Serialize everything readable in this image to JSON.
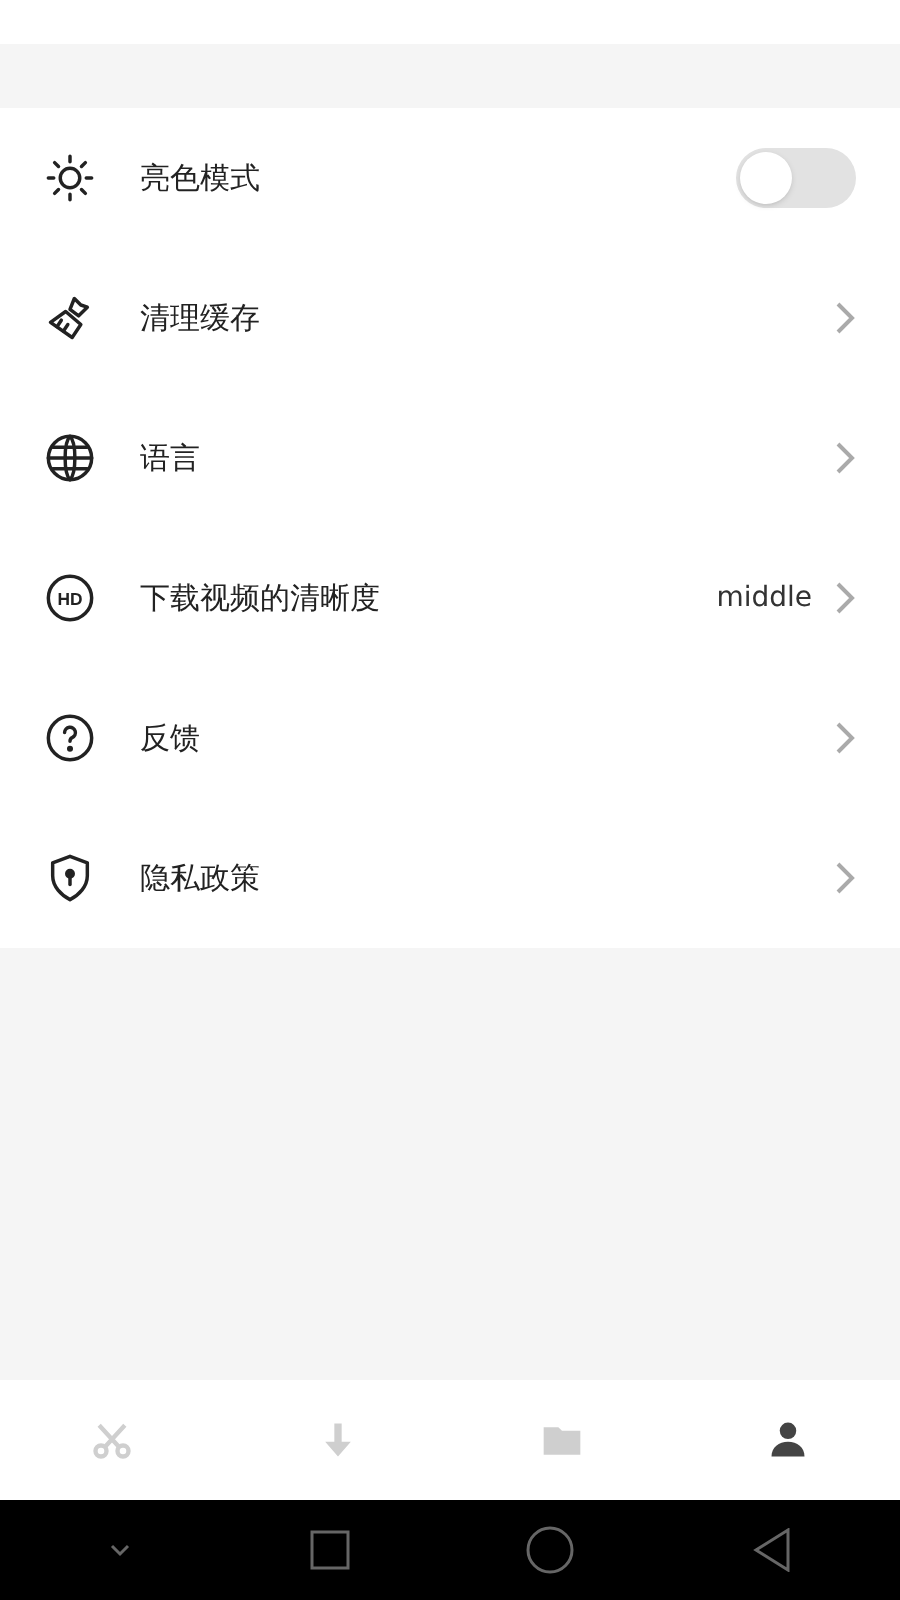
{
  "settings": [
    {
      "kind": "toggle",
      "label": "亮色模式",
      "on": false
    },
    {
      "kind": "link",
      "label": "清理缓存"
    },
    {
      "kind": "link",
      "label": "语言"
    },
    {
      "kind": "link",
      "label": "下载视频的清晰度",
      "icon_text": "HD",
      "value": "middle"
    },
    {
      "kind": "link",
      "label": "反馈"
    },
    {
      "kind": "link",
      "label": "隐私政策"
    }
  ],
  "tabs": [
    {
      "selected": false
    },
    {
      "selected": false
    },
    {
      "selected": false
    },
    {
      "selected": true
    }
  ]
}
